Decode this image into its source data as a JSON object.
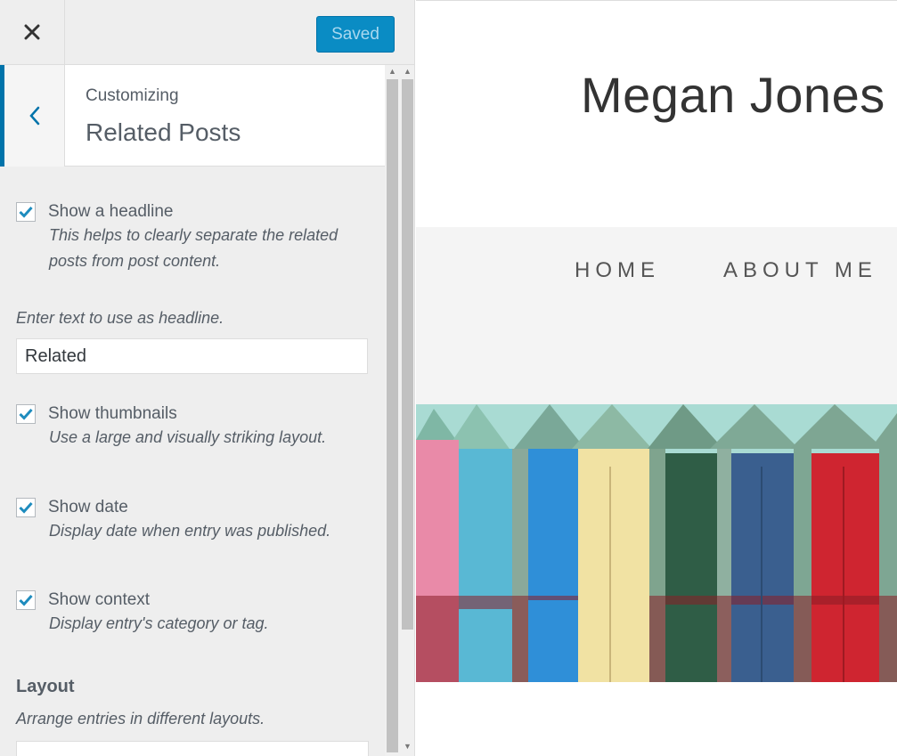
{
  "topbar": {
    "close_icon": "close-icon",
    "save_label": "Saved"
  },
  "section": {
    "subtitle": "Customizing",
    "title": "Related Posts"
  },
  "controls": {
    "headline": {
      "checked": true,
      "label": "Show a headline",
      "description": "This helps to clearly separate the related posts from post content."
    },
    "headline_text": {
      "description": "Enter text to use as headline.",
      "value": "Related"
    },
    "thumbnails": {
      "checked": true,
      "label": "Show thumbnails",
      "description": "Use a large and visually striking layout."
    },
    "date": {
      "checked": true,
      "label": "Show date",
      "description": "Display date when entry was published."
    },
    "context": {
      "checked": true,
      "label": "Show context",
      "description": "Display entry's category or tag."
    },
    "layout": {
      "title": "Layout",
      "description": "Arrange entries in different layouts."
    }
  },
  "preview": {
    "site_title": "Megan Jones",
    "nav": [
      "HOME",
      "ABOUT ME"
    ]
  },
  "colors": {
    "accent": "#0073aa",
    "saved_button": "#0a8cc4",
    "check": "#1e8cbe"
  }
}
